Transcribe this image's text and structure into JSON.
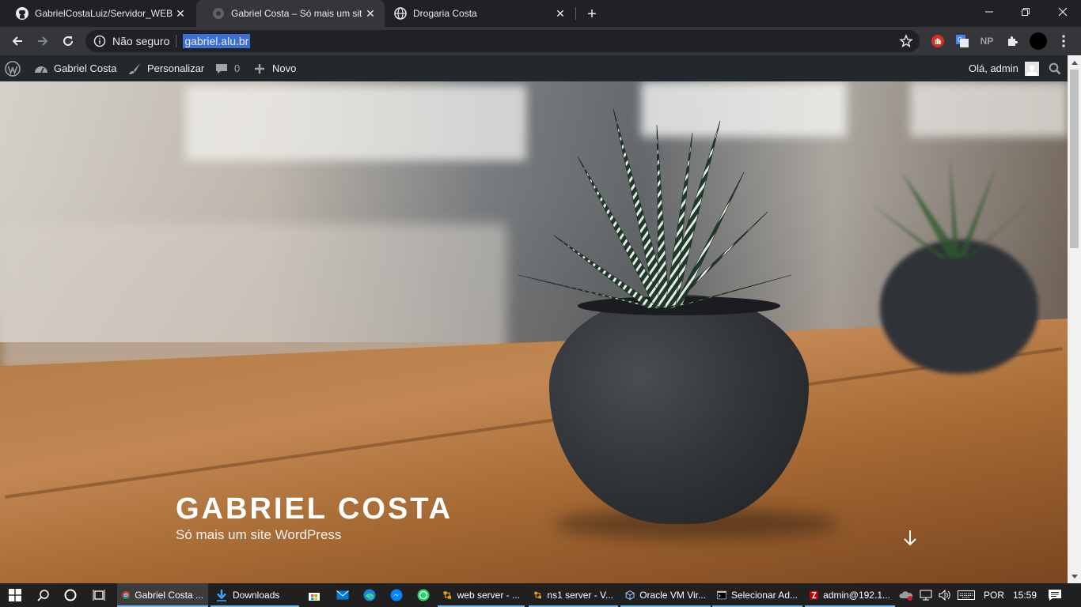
{
  "browser": {
    "tabs": [
      {
        "title": "GabrielCostaLuiz/Servidor_WEB",
        "icon": "github-icon",
        "active": false
      },
      {
        "title": "Gabriel Costa – Só mais um site W",
        "icon": "globe-icon",
        "active": true
      },
      {
        "title": "Drogaria Costa",
        "icon": "globe-icon",
        "active": false
      }
    ],
    "close_glyph": "✕",
    "new_tab_glyph": "+",
    "security_label": "Não seguro",
    "url": "gabriel.alu.br",
    "ext_np_label": "NP"
  },
  "adminbar": {
    "site_name": "Gabriel Costa",
    "customize": "Personalizar",
    "comments_count": "0",
    "new": "Novo",
    "greeting": "Olá, admin"
  },
  "hero": {
    "site_title": "GABRIEL COSTA",
    "tagline": "Só mais um site WordPress"
  },
  "taskbar": {
    "apps": [
      {
        "label": "Gabriel Costa ...",
        "icon": "chrome-icon",
        "active": true
      },
      {
        "label": "Downloads",
        "icon": "download-folder-icon",
        "active": false
      },
      {
        "label": "web server - ...",
        "icon": "network-icon",
        "active": false
      },
      {
        "label": "ns1 server - V...",
        "icon": "network-icon",
        "active": false
      },
      {
        "label": "Oracle VM Vir...",
        "icon": "virtualbox-icon",
        "active": false
      },
      {
        "label": "Selecionar Ad...",
        "icon": "cmd-icon",
        "active": false
      },
      {
        "label": "admin@192.1...",
        "icon": "filezilla-icon",
        "active": false
      }
    ],
    "language": "POR",
    "time": "15:59"
  }
}
